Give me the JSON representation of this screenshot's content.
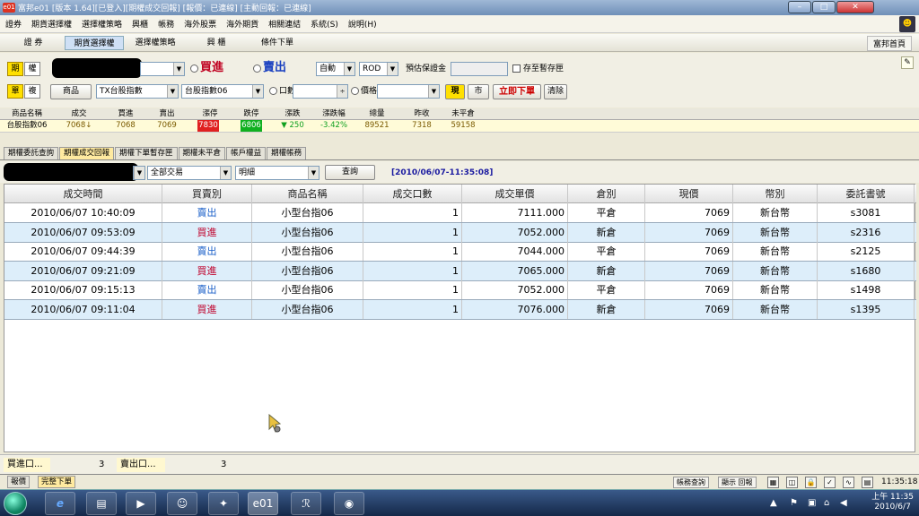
{
  "window": {
    "title": "富邦e01 [版本 1.64][已登入][期權成交回報] [報價：已連線] [主動回報：已連線]",
    "logo": "e01"
  },
  "menu": [
    "證券",
    "期貨選擇權",
    "選擇權策略",
    "興櫃",
    "帳務",
    "海外股票",
    "海外期貨",
    "相關連結",
    "系統(S)",
    "說明(H)"
  ],
  "toolbar": {
    "tabs": [
      "證 券",
      "期貨選擇權",
      "選擇權策略",
      "興 櫃",
      "條件下單"
    ],
    "home": "富邦首頁"
  },
  "order": {
    "row1": {
      "futures": "期",
      "options": "權",
      "buy_label": "買進",
      "sell_label": "賣出",
      "ordertype": "自動",
      "timeinforce": "ROD",
      "margin_label": "預估保證金",
      "save_temp": "存至暫存匣"
    },
    "row2": {
      "single": "單",
      "compound": "複",
      "product_btn": "商品",
      "product": "TX台股指數",
      "contract": "台股指數06",
      "qty_label": "口數",
      "price_label": "價格",
      "now_btn": "現",
      "market_btn": "市",
      "submit": "立即下單",
      "clear": "清除"
    }
  },
  "quote": {
    "headers": [
      "商品名稱",
      "成交",
      "買進",
      "賣出",
      "漲停",
      "跌停",
      "漲跌",
      "漲跌幅",
      "總量",
      "昨收",
      "未平倉"
    ],
    "row": [
      "台股指數06",
      "7068↓",
      "7068",
      "7069",
      "7830",
      "6806",
      "▼ 250",
      "-3.42%",
      "89521",
      "7318",
      "59158"
    ]
  },
  "subtabs": [
    "期權委託查詢",
    "期權成交回報",
    "期權下單暫存匣",
    "期權未平倉",
    "帳戶權益",
    "期權帳務"
  ],
  "query": {
    "filter": "全部交易",
    "detail": "明細",
    "button": "查詢",
    "timestamp": "[2010/06/07-11:35:08]"
  },
  "grid": {
    "headers": [
      "成交時間",
      "買賣別",
      "商品名稱",
      "成交口數",
      "成交單價",
      "倉別",
      "現價",
      "幣別",
      "委託書號"
    ],
    "rows": [
      [
        "2010/06/07 10:40:09",
        "賣出",
        "小型台指06",
        "1",
        "7111.000",
        "平倉",
        "7069",
        "新台幣",
        "s3081"
      ],
      [
        "2010/06/07 09:53:09",
        "買進",
        "小型台指06",
        "1",
        "7052.000",
        "新倉",
        "7069",
        "新台幣",
        "s2316"
      ],
      [
        "2010/06/07 09:44:39",
        "賣出",
        "小型台指06",
        "1",
        "7044.000",
        "平倉",
        "7069",
        "新台幣",
        "s2125"
      ],
      [
        "2010/06/07 09:21:09",
        "買進",
        "小型台指06",
        "1",
        "7065.000",
        "新倉",
        "7069",
        "新台幣",
        "s1680"
      ],
      [
        "2010/06/07 09:15:13",
        "賣出",
        "小型台指06",
        "1",
        "7052.000",
        "平倉",
        "7069",
        "新台幣",
        "s1498"
      ],
      [
        "2010/06/07 09:11:04",
        "買進",
        "小型台指06",
        "1",
        "7076.000",
        "新倉",
        "7069",
        "新台幣",
        "s1395"
      ]
    ]
  },
  "summary": {
    "buy_label": "買進口...",
    "buy_value": "3",
    "sell_label": "賣出口...",
    "sell_value": "3"
  },
  "bottom": {
    "tabs": [
      "報價",
      "完整下單"
    ],
    "account_btn": "帳務查詢",
    "report_btn": "顯示 回報",
    "time": "11:35:18"
  },
  "taskbar": {
    "clock_time": "上午 11:35",
    "clock_date": "2010/6/7"
  },
  "colors": {
    "limit_up": "#e02020",
    "limit_down": "#10b020",
    "sell": "#1a5fc8",
    "buy": "#c0002a",
    "row_alt": "#ddeefa"
  }
}
